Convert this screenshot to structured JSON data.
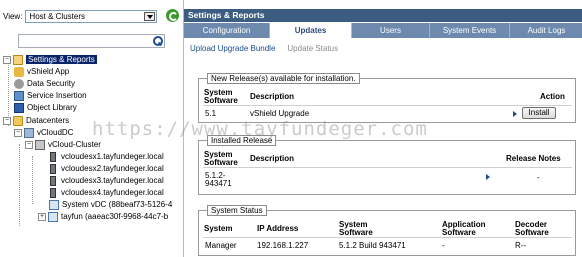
{
  "left": {
    "view_label": "View:",
    "view_value": "Host & Clusters",
    "search_value": "",
    "tree": {
      "settings_reports": "Settings & Reports",
      "vshield_app": "vShield App",
      "data_security": "Data Security",
      "service_insertion": "Service Insertion",
      "object_library": "Object Library",
      "datacenters": "Datacenters",
      "vclouddc": "vCloudDC",
      "vcloud_cluster": "vCloud-Cluster",
      "hosts": [
        "vcloudesx1.tayfundeger.local",
        "vcloudesx2.tayfundeger.local",
        "vcloudesx3.tayfundeger.local",
        "vcloudesx4.tayfundeger.local"
      ],
      "system_vdc": "System vDC (88beaf73-5126-4",
      "tayfun_vdc": "tayfun (aaeac30f-9968-44c7-b"
    }
  },
  "right": {
    "title": "Settings & Reports",
    "tabs": [
      "Configuration",
      "Updates",
      "Users",
      "System Events",
      "Audit Logs"
    ],
    "active_tab": "Updates",
    "links": {
      "upload": "Upload Upgrade Bundle",
      "status": "Update Status"
    },
    "new_release": {
      "legend": "New Release(s) available for installation.",
      "col_software_1": "System",
      "col_software_2": "Software",
      "col_description": "Description",
      "col_action": "Action",
      "row_version": "5.1",
      "row_description": "vShield Upgrade",
      "install_label": "Install"
    },
    "installed": {
      "legend": "Installed Release",
      "col_software_1": "System",
      "col_software_2": "Software",
      "col_description": "Description",
      "col_notes": "Release Notes",
      "row_version_1": "5.1.2-",
      "row_version_2": "943471",
      "row_notes": "-"
    },
    "system_status": {
      "legend": "System Status",
      "col_system": "System",
      "col_ip": "IP Address",
      "col_sys_sw_1": "System",
      "col_sys_sw_2": "Software",
      "col_app_sw_1": "Application",
      "col_app_sw_2": "Software",
      "col_dec_sw_1": "Decoder",
      "col_dec_sw_2": "Software",
      "row_system": "Manager",
      "row_ip": "192.168.1.227",
      "row_sys_sw": "5.1.2 Build 943471",
      "row_app_sw": "-",
      "row_dec_sw": "R--"
    }
  },
  "watermark": "https://www.tayfundeger.com",
  "colors": {
    "title_bar": "#3d5c82",
    "tab_bar": "#6d8aae",
    "selection": "#0a246a",
    "link": "#1a4e8c"
  }
}
